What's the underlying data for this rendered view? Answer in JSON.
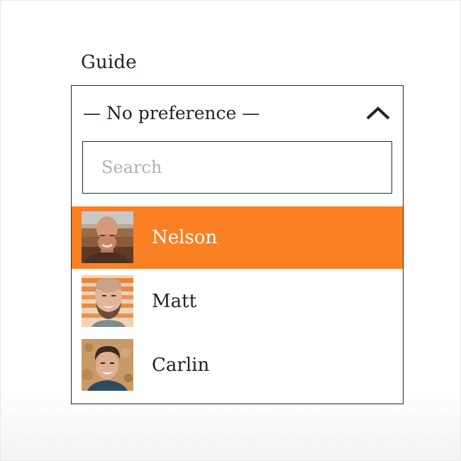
{
  "field": {
    "label": "Guide"
  },
  "select": {
    "selected_value": "— No preference —",
    "expanded_icon": "chevron-up-icon"
  },
  "search": {
    "value": "",
    "placeholder": "Search"
  },
  "options": [
    {
      "label": "Nelson",
      "avatar": "avatar-photo",
      "highlighted": true
    },
    {
      "label": "Matt",
      "avatar": "avatar-photo",
      "highlighted": false
    },
    {
      "label": "Carlin",
      "avatar": "avatar-photo",
      "highlighted": false
    }
  ],
  "colors": {
    "highlight": "#fb7f23",
    "text": "#2a211c",
    "border": "#2f2622",
    "placeholder": "#b4b0ad"
  }
}
